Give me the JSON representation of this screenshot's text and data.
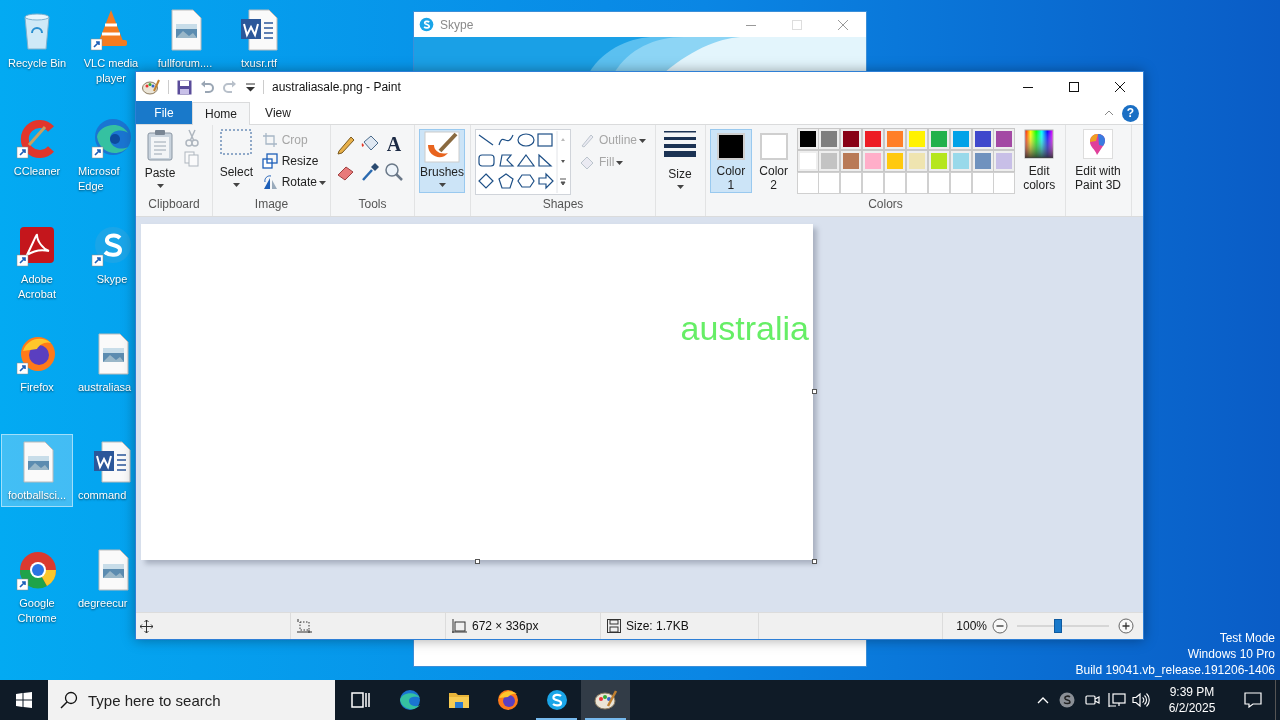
{
  "desktop": {
    "icon_columns": [
      {
        "icons": [
          {
            "label": "Recycle Bin",
            "kind": "recycle-bin",
            "shortcut": false,
            "clipped": false,
            "selected": false
          },
          {
            "label": "CCleaner",
            "kind": "ccleaner",
            "shortcut": true,
            "clipped": false,
            "selected": false
          },
          {
            "label": "Adobe Acrobat",
            "kind": "acrobat",
            "shortcut": true,
            "clipped": false,
            "selected": false
          },
          {
            "label": "Firefox",
            "kind": "firefox",
            "shortcut": true,
            "clipped": false,
            "selected": false
          },
          {
            "label": "footballsci...",
            "kind": "image-file",
            "shortcut": false,
            "clipped": false,
            "selected": true
          },
          {
            "label": "Google Chrome",
            "kind": "chrome",
            "shortcut": true,
            "clipped": false,
            "selected": false
          }
        ]
      },
      {
        "icons": [
          {
            "label": "VLC media player",
            "kind": "vlc",
            "shortcut": true,
            "clipped": false,
            "selected": false
          },
          {
            "label": "Microsof Edge",
            "kind": "edge",
            "shortcut": true,
            "clipped": true,
            "selected": false
          },
          {
            "label": "Skype",
            "kind": "skype",
            "shortcut": true,
            "clipped": false,
            "selected": false
          },
          {
            "label": "australiasa",
            "kind": "image-file",
            "shortcut": false,
            "clipped": true,
            "selected": false
          },
          {
            "label": "command",
            "kind": "word-file",
            "shortcut": false,
            "clipped": true,
            "selected": false
          },
          {
            "label": "degreecur",
            "kind": "image-file",
            "shortcut": false,
            "clipped": true,
            "selected": false
          }
        ]
      },
      {
        "icons": [
          {
            "label": "fullforum....",
            "kind": "image-file",
            "shortcut": false,
            "clipped": false,
            "selected": false
          }
        ]
      },
      {
        "icons": [
          {
            "label": "txusr.rtf",
            "kind": "word-file",
            "shortcut": false,
            "clipped": false,
            "selected": false
          }
        ]
      }
    ],
    "system_info": [
      "Test Mode",
      "Windows 10 Pro",
      "Build 19041.vb_release.191206-1406"
    ]
  },
  "skype_window": {
    "title": "Skype"
  },
  "paint": {
    "title": "australiasale.png - Paint",
    "tabs": [
      {
        "label": "File",
        "kind": "file",
        "selected": false
      },
      {
        "label": "Home",
        "kind": "tab",
        "selected": true
      },
      {
        "label": "View",
        "kind": "tab",
        "selected": false
      }
    ],
    "help": "?",
    "ribbon": {
      "clipboard": {
        "label": "Clipboard",
        "paste": "Paste"
      },
      "image": {
        "label": "Image",
        "select": "Select",
        "crop": {
          "label": "Crop",
          "disabled": true
        },
        "resize": {
          "label": "Resize",
          "disabled": false
        },
        "rotate": {
          "label": "Rotate",
          "disabled": false
        }
      },
      "tools": {
        "label": "Tools",
        "text_tool": "A"
      },
      "brushes": {
        "label": "Brushes",
        "selected": true
      },
      "shapes": {
        "label": "Shapes",
        "outline": {
          "label": "Outline",
          "disabled": true
        },
        "fill": {
          "label": "Fill",
          "disabled": true
        }
      },
      "size": {
        "label": "Size"
      },
      "colors": {
        "label": "Colors",
        "color_1": {
          "label": "Color 1",
          "color": "#000000",
          "selected": true
        },
        "color_2": {
          "label": "Color 2",
          "color": "#ffffff",
          "selected": false
        },
        "palette": [
          {
            "color": "#000000"
          },
          {
            "color": "#7f7f7f"
          },
          {
            "color": "#880015"
          },
          {
            "color": "#ed1c24"
          },
          {
            "color": "#ff7f27"
          },
          {
            "color": "#fff200"
          },
          {
            "color": "#22b14c"
          },
          {
            "color": "#00a2e8"
          },
          {
            "color": "#3f48cc"
          },
          {
            "color": "#a349a4"
          },
          {
            "color": "#ffffff"
          },
          {
            "color": "#c3c3c3"
          },
          {
            "color": "#b97a57"
          },
          {
            "color": "#ffaec9"
          },
          {
            "color": "#ffc90e"
          },
          {
            "color": "#efe4b0"
          },
          {
            "color": "#b5e61d"
          },
          {
            "color": "#99d9ea"
          },
          {
            "color": "#7092be"
          },
          {
            "color": "#c8bfe7"
          }
        ],
        "edit_colors": "Edit colors"
      },
      "paint3d": "Edit with Paint 3D"
    },
    "canvas": {
      "text": "australia",
      "color": "#66ee66"
    },
    "status_bar": {
      "dimensions": "672 × 336px",
      "file_size": "Size: 1.7KB",
      "zoom": {
        "label": "100%",
        "level": 0.45
      }
    }
  },
  "taskbar": {
    "search_placeholder": "Type here to search",
    "apps": [
      {
        "kind": "task-view",
        "running": false,
        "active": false
      },
      {
        "kind": "edge",
        "running": false,
        "active": false
      },
      {
        "kind": "explorer",
        "running": false,
        "active": false
      },
      {
        "kind": "firefox",
        "running": false,
        "active": false
      },
      {
        "kind": "skype",
        "running": true,
        "active": false
      },
      {
        "kind": "paint",
        "running": true,
        "active": true
      }
    ],
    "clock": {
      "time": "9:39 PM",
      "date": "6/2/2025"
    }
  }
}
